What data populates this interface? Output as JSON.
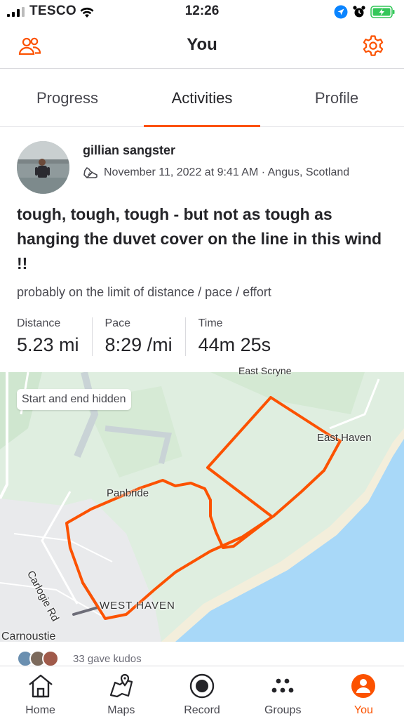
{
  "status_bar": {
    "carrier": "TESCO",
    "time": "12:26"
  },
  "header": {
    "title": "You"
  },
  "tabs": [
    {
      "label": "Progress",
      "active": false
    },
    {
      "label": "Activities",
      "active": true
    },
    {
      "label": "Profile",
      "active": false
    }
  ],
  "activity": {
    "athlete_name": "gillian sangster",
    "datetime_location": "November 11, 2022 at 9:41 AM · Angus, Scotland",
    "title": "tough, tough, tough - but not as tough as hanging the duvet cover on the line in this wind !!",
    "description": "probably on the limit of distance / pace / effort",
    "stats": [
      {
        "label": "Distance",
        "value": "5.23 mi"
      },
      {
        "label": "Pace",
        "value": "8:29 /mi"
      },
      {
        "label": "Time",
        "value": "44m 25s"
      }
    ]
  },
  "map": {
    "privacy_label": "Start and end hidden",
    "place_labels": {
      "east_scryne": "East Scryne",
      "east_haven": "East Haven",
      "panbride": "Panbride",
      "carlogie_rd": "Carlogie Rd",
      "west_haven": "WEST HAVEN",
      "carnoustie": "Carnoustie"
    },
    "route_color": "#fc5200",
    "water_color": "#a8d8f8"
  },
  "kudos": {
    "text": "33 gave kudos"
  },
  "nav": [
    {
      "label": "Home",
      "icon": "home-icon",
      "active": false
    },
    {
      "label": "Maps",
      "icon": "maps-icon",
      "active": false
    },
    {
      "label": "Record",
      "icon": "record-icon",
      "active": false
    },
    {
      "label": "Groups",
      "icon": "groups-icon",
      "active": false
    },
    {
      "label": "You",
      "icon": "you-icon",
      "active": true
    }
  ],
  "colors": {
    "accent": "#fc5200",
    "text": "#242428",
    "secondary_text": "#494950"
  }
}
